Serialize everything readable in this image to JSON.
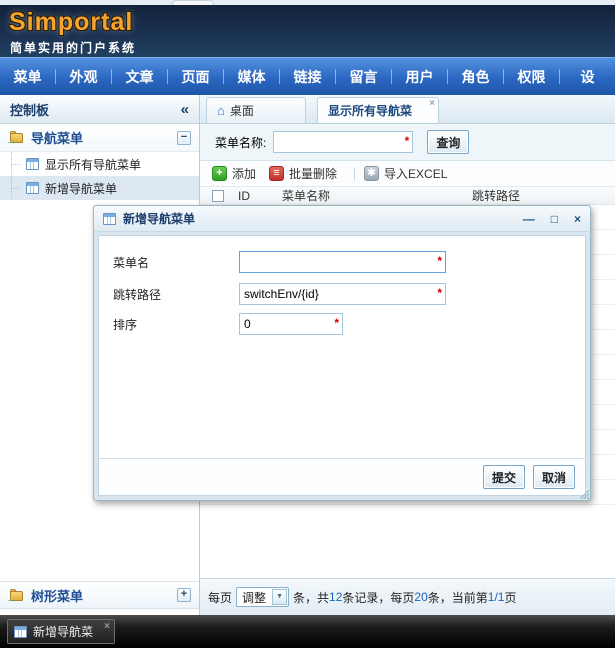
{
  "app": {
    "logo": "Simportal",
    "subtitle": "简单实用的门户系统"
  },
  "menubar": {
    "items": [
      "菜单",
      "外观",
      "文章",
      "页面",
      "媒体",
      "链接",
      "留言",
      "用户",
      "角色",
      "权限",
      "设"
    ]
  },
  "sidebar": {
    "header": "控制板",
    "nav_panel": {
      "title": "导航菜单",
      "items": [
        "显示所有导航菜单",
        "新增导航菜单"
      ]
    },
    "tree_panel": {
      "title": "树形菜单"
    }
  },
  "tabs": {
    "desktop": "桌面",
    "active": "显示所有导航菜"
  },
  "search": {
    "label": "菜单名称:",
    "value": "",
    "button": "查询"
  },
  "toolbar": {
    "add": "添加",
    "batch_delete": "批量删除",
    "import_excel": "导入EXCEL"
  },
  "table": {
    "columns": [
      "ID",
      "菜单名称",
      "跳转路径"
    ]
  },
  "pagination": {
    "prefix": "每页",
    "select_value": "调整",
    "mid1": "条，共",
    "total": "12",
    "mid2": "条记录，每页",
    "page_size": "20",
    "mid3": "条，当前第",
    "page": "1/1",
    "suffix": "页"
  },
  "dialog": {
    "title": "新增导航菜单",
    "fields": {
      "name": {
        "label": "菜单名",
        "value": ""
      },
      "path": {
        "label": "跳转路径",
        "value": "switchEnv/{id}"
      },
      "sort": {
        "label": "排序",
        "value": "0"
      }
    },
    "submit": "提交",
    "cancel": "取消"
  },
  "taskbar": {
    "item": "新增导航菜"
  },
  "icons": {
    "collapse": "«",
    "minus": "−",
    "plus": "+",
    "home": "⌂",
    "close": "×",
    "minimize": "—",
    "maximize": "□",
    "dropdown": "▼",
    "add": "+",
    "batch_delete": "≡",
    "import_excel": "✱",
    "required": "*",
    "folder_arrow": "→"
  },
  "colors": {
    "accent_blue": "#2a66c0",
    "header_navy": "#1a3150",
    "logo_orange": "#f5a52e",
    "required_red": "#d40000",
    "add_green": "#2f9e26",
    "delete_red": "#c03028",
    "selected_item_bg": "#dce7f1"
  }
}
